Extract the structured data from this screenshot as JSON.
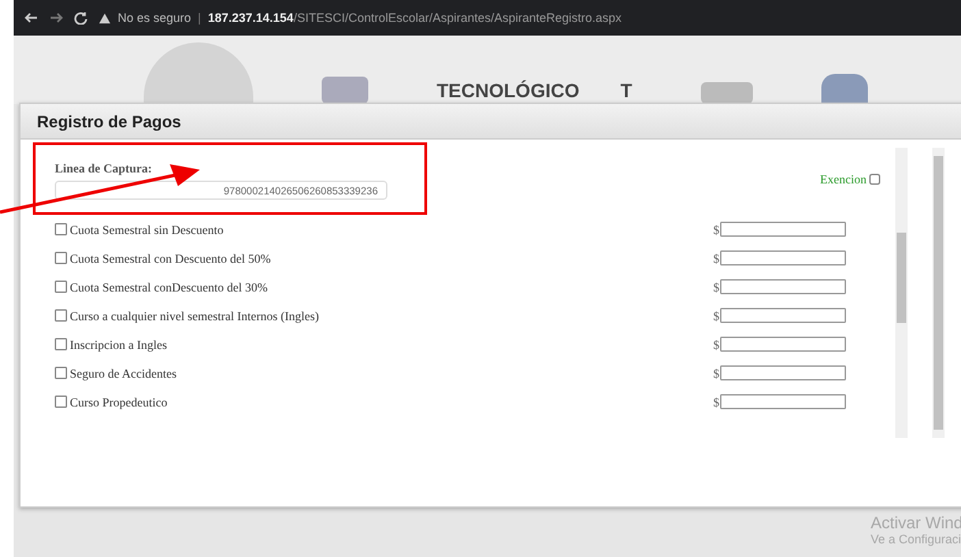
{
  "browser": {
    "security_label": "No es seguro",
    "separator": "|",
    "url_host": "187.237.14.154",
    "url_path": "/SITESCI/ControlEscolar/Aspirantes/AspiranteRegistro.aspx"
  },
  "header": {
    "title": "TECNOLÓGICO",
    "letter": "T"
  },
  "modal": {
    "title": "Registro de Pagos",
    "capture_label": "Linea de Captura:",
    "capture_value": "978000214026506260853339236",
    "exemption": {
      "label": "Exencion",
      "checked": false
    },
    "currency": "$",
    "items": [
      {
        "label": "Cuota Semestral sin Descuento",
        "checked": false
      },
      {
        "label": "Cuota Semestral con Descuento del 50%",
        "checked": false
      },
      {
        "label": "Cuota Semestral conDescuento del 30%",
        "checked": false
      },
      {
        "label": "Curso a cualquier nivel semestral Internos (Ingles)",
        "checked": false
      },
      {
        "label": "Inscripcion a Ingles",
        "checked": false
      },
      {
        "label": "Seguro de Accidentes",
        "checked": false
      },
      {
        "label": "Curso Propedeutico",
        "checked": false
      }
    ]
  },
  "os_notice": {
    "title": "Activar Wind",
    "subtitle": "Ve a Configuraci"
  }
}
